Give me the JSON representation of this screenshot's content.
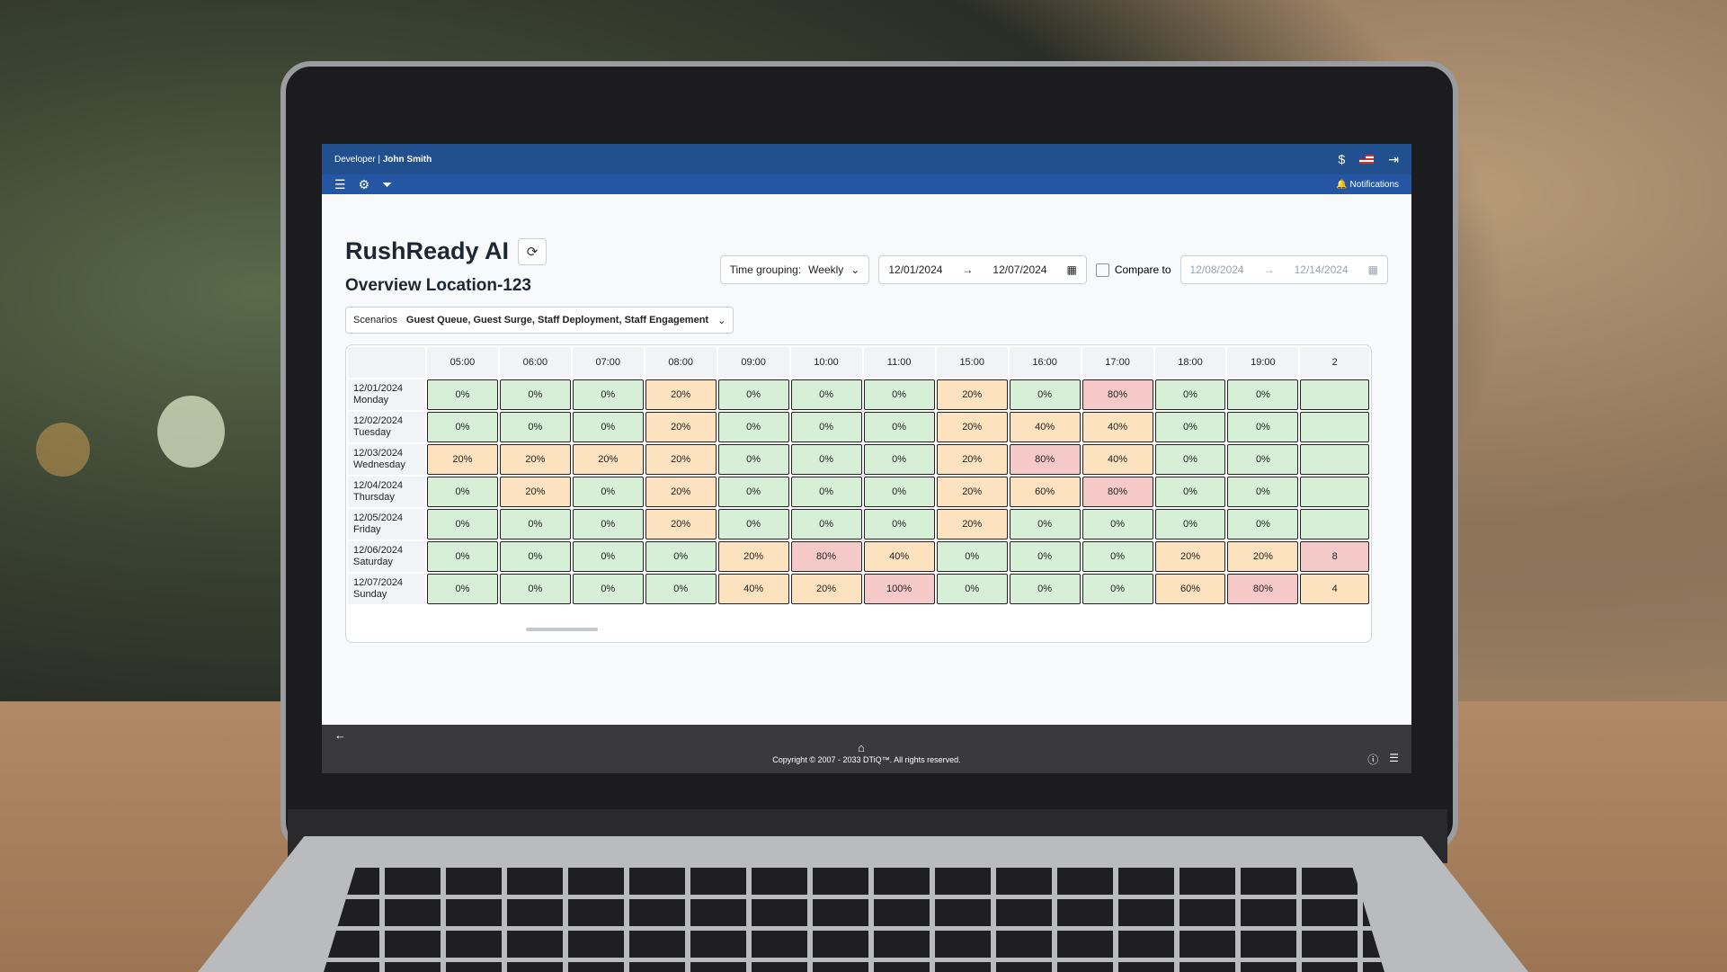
{
  "header": {
    "role": "Developer",
    "user": "John Smith",
    "notifications_label": "Notifications"
  },
  "app": {
    "title": "RushReady AI",
    "subtitle": "Overview Location-123"
  },
  "controls": {
    "time_grouping_label": "Time grouping:",
    "time_grouping_value": "Weekly",
    "date_from": "12/01/2024",
    "date_to": "12/07/2024",
    "compare_label": "Compare to",
    "compare_from": "12/08/2024",
    "compare_to": "12/14/2024"
  },
  "scenarios": {
    "label": "Scenarios",
    "value": "Guest Queue, Guest Surge, Staff Deployment, Staff Engagement"
  },
  "grid": {
    "hours": [
      "05:00",
      "06:00",
      "07:00",
      "08:00",
      "09:00",
      "10:00",
      "11:00",
      "15:00",
      "16:00",
      "17:00",
      "18:00",
      "19:00",
      "2"
    ],
    "rows": [
      {
        "date": "12/01/2024",
        "day": "Monday",
        "values": [
          "0%",
          "0%",
          "0%",
          "20%",
          "0%",
          "0%",
          "0%",
          "20%",
          "0%",
          "80%",
          "0%",
          "0%",
          ""
        ]
      },
      {
        "date": "12/02/2024",
        "day": "Tuesday",
        "values": [
          "0%",
          "0%",
          "0%",
          "20%",
          "0%",
          "0%",
          "0%",
          "20%",
          "40%",
          "40%",
          "0%",
          "0%",
          ""
        ]
      },
      {
        "date": "12/03/2024",
        "day": "Wednesday",
        "values": [
          "20%",
          "20%",
          "20%",
          "20%",
          "0%",
          "0%",
          "0%",
          "20%",
          "80%",
          "40%",
          "0%",
          "0%",
          ""
        ]
      },
      {
        "date": "12/04/2024",
        "day": "Thursday",
        "values": [
          "0%",
          "20%",
          "0%",
          "20%",
          "0%",
          "0%",
          "0%",
          "20%",
          "60%",
          "80%",
          "0%",
          "0%",
          ""
        ]
      },
      {
        "date": "12/05/2024",
        "day": "Friday",
        "values": [
          "0%",
          "0%",
          "0%",
          "20%",
          "0%",
          "0%",
          "0%",
          "20%",
          "0%",
          "0%",
          "0%",
          "0%",
          ""
        ]
      },
      {
        "date": "12/06/2024",
        "day": "Saturday",
        "values": [
          "0%",
          "0%",
          "0%",
          "0%",
          "20%",
          "80%",
          "40%",
          "0%",
          "0%",
          "0%",
          "20%",
          "20%",
          "8"
        ]
      },
      {
        "date": "12/07/2024",
        "day": "Sunday",
        "values": [
          "0%",
          "0%",
          "0%",
          "0%",
          "40%",
          "20%",
          "100%",
          "0%",
          "0%",
          "0%",
          "60%",
          "80%",
          "4"
        ]
      }
    ]
  },
  "footer": {
    "copyright": "Copyright © 2007 - 2033 DTiQ™. All rights reserved."
  },
  "colors": {
    "low": "#d6efd6",
    "mid": "#fde2c0",
    "high": "#f6c9c9",
    "brand": "#22508f"
  }
}
